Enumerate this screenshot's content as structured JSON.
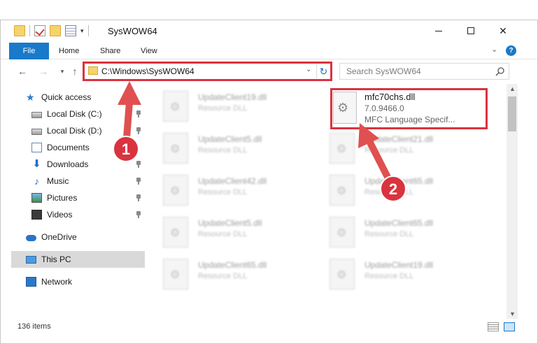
{
  "window": {
    "title": "SysWOW64",
    "minimize_label": "",
    "maximize_label": "",
    "close_label": "✕"
  },
  "ribbon": {
    "tabs": [
      {
        "label": "File"
      },
      {
        "label": "Home"
      },
      {
        "label": "Share"
      },
      {
        "label": "View"
      }
    ],
    "help_label": "?"
  },
  "address": {
    "path": "C:\\Windows\\SysWOW64",
    "refresh_icon": "↻"
  },
  "search": {
    "placeholder": "Search SysWOW64"
  },
  "navpane": {
    "items": [
      {
        "label": "Quick access",
        "icon": "star-icon"
      },
      {
        "label": "Local Disk (C:)",
        "icon": "drive-icon",
        "pinned": true
      },
      {
        "label": "Local Disk (D:)",
        "icon": "drive-icon",
        "pinned": true
      },
      {
        "label": "Documents",
        "icon": "documents-icon",
        "pinned": true
      },
      {
        "label": "Downloads",
        "icon": "download-icon",
        "pinned": true
      },
      {
        "label": "Music",
        "icon": "music-icon",
        "pinned": true
      },
      {
        "label": "Pictures",
        "icon": "pictures-icon",
        "pinned": true
      },
      {
        "label": "Videos",
        "icon": "videos-icon",
        "pinned": true
      },
      {
        "label": "OneDrive",
        "icon": "cloud-icon"
      },
      {
        "label": "This PC",
        "icon": "computer-icon",
        "selected": true
      },
      {
        "label": "Network",
        "icon": "network-icon"
      }
    ]
  },
  "files": {
    "left_column": [
      {
        "name": "UpdateClient19.dll",
        "type": "Resource DLL"
      },
      {
        "name": "UpdateClient5.dll",
        "type": "Resource DLL"
      },
      {
        "name": "UpdateClient42.dll",
        "type": "Resource DLL"
      },
      {
        "name": "UpdateClient5.dll",
        "type": "Resource DLL"
      },
      {
        "name": "UpdateClient65.dll",
        "type": "Resource DLL"
      }
    ],
    "right_column": [
      {
        "name": "UpdateClient21.dll",
        "type": "Resource DLL"
      },
      {
        "name": "UpdateClient65.dll",
        "type": "Resource DLL"
      },
      {
        "name": "UpdateClient65.dll",
        "type": "Resource DLL"
      },
      {
        "name": "UpdateClient19.dll",
        "type": "Resource DLL"
      }
    ],
    "selected": {
      "name": "mfc70chs.dll",
      "version": "7.0.9466.0",
      "description": "MFC Language Specif..."
    }
  },
  "status": {
    "item_count": "136 items"
  },
  "annotations": {
    "step1": "1",
    "step2": "2",
    "color": "#d9333f"
  }
}
